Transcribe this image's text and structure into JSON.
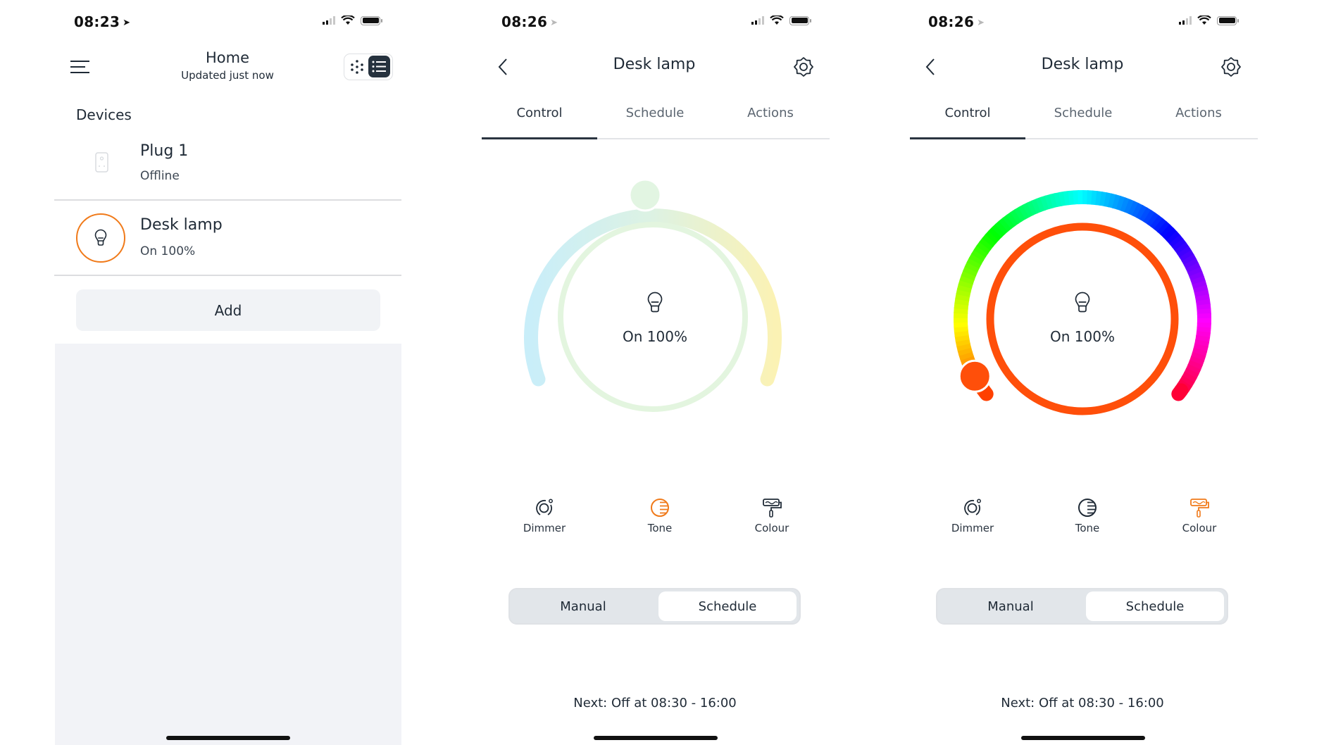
{
  "screens": [
    {
      "status_bar": {
        "time": "08:23",
        "location_active": true
      },
      "header": {
        "title": "Home",
        "subtitle": "Updated just now",
        "view_toggle": [
          "grid-view",
          "list-view"
        ],
        "view_selected": "list-view"
      },
      "section_title": "Devices",
      "devices": [
        {
          "name": "Plug 1",
          "status": "Offline",
          "icon": "plug-icon",
          "active": false
        },
        {
          "name": "Desk lamp",
          "status": "On 100%",
          "icon": "bulb-icon",
          "active": true
        }
      ],
      "add_label": "Add"
    },
    {
      "status_bar": {
        "time": "08:26",
        "location_active": false
      },
      "header": {
        "title": "Desk lamp"
      },
      "tabs": [
        {
          "label": "Control",
          "active": true
        },
        {
          "label": "Schedule",
          "active": false
        },
        {
          "label": "Actions",
          "active": false
        }
      ],
      "dial": {
        "mode": "tone",
        "state_label": "On 100%",
        "brightness_percent": 100,
        "tone_position": 0.5
      },
      "modes": [
        {
          "label": "Dimmer",
          "icon": "dimmer-icon",
          "active": false
        },
        {
          "label": "Tone",
          "icon": "tone-icon",
          "active": true
        },
        {
          "label": "Colour",
          "icon": "colour-icon",
          "active": false
        }
      ],
      "segmented": {
        "options": [
          "Manual",
          "Schedule"
        ],
        "selected": "Schedule"
      },
      "next_schedule": "Next: Off at 08:30 - 16:00"
    },
    {
      "status_bar": {
        "time": "08:26",
        "location_active": false
      },
      "header": {
        "title": "Desk lamp"
      },
      "tabs": [
        {
          "label": "Control",
          "active": true
        },
        {
          "label": "Schedule",
          "active": false
        },
        {
          "label": "Actions",
          "active": false
        }
      ],
      "dial": {
        "mode": "colour",
        "state_label": "On 100%",
        "brightness_percent": 100,
        "hue_position": 0.0,
        "selected_colour": "#ff4f0a"
      },
      "modes": [
        {
          "label": "Dimmer",
          "icon": "dimmer-icon",
          "active": false
        },
        {
          "label": "Tone",
          "icon": "tone-icon",
          "active": false
        },
        {
          "label": "Colour",
          "icon": "colour-icon",
          "active": true
        }
      ],
      "segmented": {
        "options": [
          "Manual",
          "Schedule"
        ],
        "selected": "Schedule"
      },
      "next_schedule": "Next: Off at 08:30 - 16:00"
    }
  ],
  "colors": {
    "accent": "#f07a1a",
    "text": "#1f2a36",
    "selected_colour": "#ff4f0a"
  }
}
